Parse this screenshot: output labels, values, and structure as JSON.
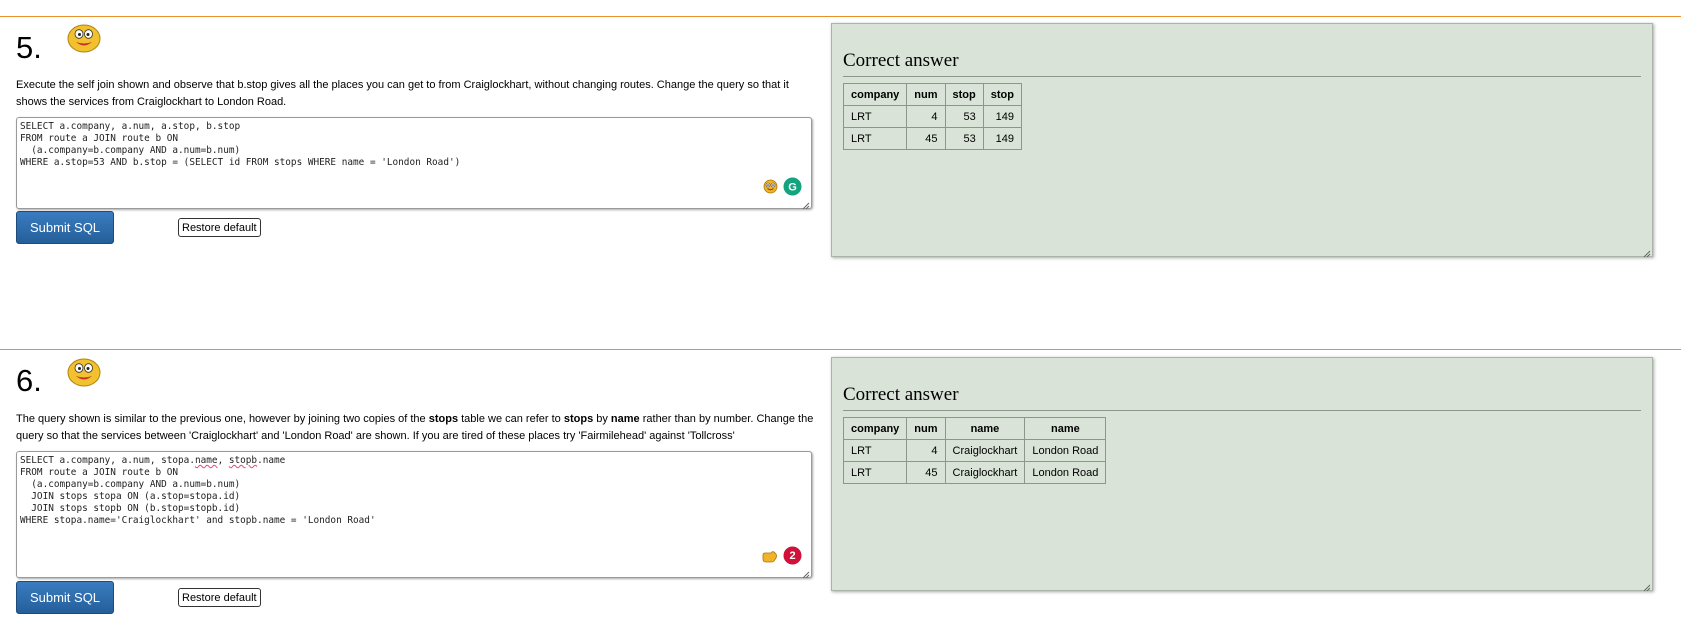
{
  "q5": {
    "number": "5.",
    "description": "Execute the self join shown and observe that b.stop gives all the places you can get to from Craiglockhart, without changing routes. Change the query so that it shows the services from Craiglockhart to London Road.",
    "code_lines": [
      "SELECT a.company, a.num, a.stop, b.stop",
      "FROM route a JOIN route b ON",
      "  (a.company=b.company AND a.num=b.num)",
      "WHERE a.stop=53 AND b.stop = (SELECT id FROM stops WHERE name = 'London Road')"
    ],
    "submit_label": "Submit SQL",
    "restore_label": "Restore default",
    "answer": {
      "heading": "Correct answer",
      "columns": [
        "company",
        "num",
        "stop",
        "stop"
      ],
      "rows": [
        [
          "LRT",
          "4",
          "53",
          "149"
        ],
        [
          "LRT",
          "45",
          "53",
          "149"
        ]
      ]
    }
  },
  "q6": {
    "number": "6.",
    "desc_parts": {
      "p1": "The query shown is similar to the previous one, however by joining two copies of the ",
      "b1": "stops",
      "p2": " table we can refer to ",
      "b2": "stops",
      "p3": " by ",
      "b3": "name",
      "p4": " rather than by number. Change the query so that the services between 'Craiglockhart' and 'London Road' are shown. If you are tired of these places try 'Fairmilehead' against 'Tollcross'"
    },
    "code_lines": [
      "SELECT a.company, a.num, stopa.name, stopb.name",
      "FROM route a JOIN route b ON",
      "  (a.company=b.company AND a.num=b.num)",
      "  JOIN stops stopa ON (a.stop=stopa.id)",
      "  JOIN stops stopb ON (b.stop=stopb.id)",
      "WHERE stopa.name='Craiglockhart' and stopb.name = 'London Road'"
    ],
    "code_line1_parts": {
      "a": "SELECT a.company, a.num, stopa.",
      "b": "name",
      "c": ", ",
      "d": "stopb",
      "e": ".name"
    },
    "submit_label": "Submit SQL",
    "restore_label": "Restore default",
    "badge_count": "2",
    "answer": {
      "heading": "Correct answer",
      "columns": [
        "company",
        "num",
        "name",
        "name"
      ],
      "rows": [
        [
          "LRT",
          "4",
          "Craiglockhart",
          "London Road"
        ],
        [
          "LRT",
          "45",
          "Craiglockhart",
          "London Road"
        ]
      ]
    }
  },
  "icons": {
    "smiley": "smiley-face-icon",
    "grammarly": "grammarly-icon",
    "emoji": "emoji-face-icon",
    "hand": "pointing-hand-icon",
    "resize": "resize-grip-icon"
  },
  "colors": {
    "separator": "#e8902a",
    "panel_bg": "#d9e3d7",
    "submit_bg": "#2f6eae",
    "grammarly": "#15a37f",
    "badge": "#d0123a"
  }
}
